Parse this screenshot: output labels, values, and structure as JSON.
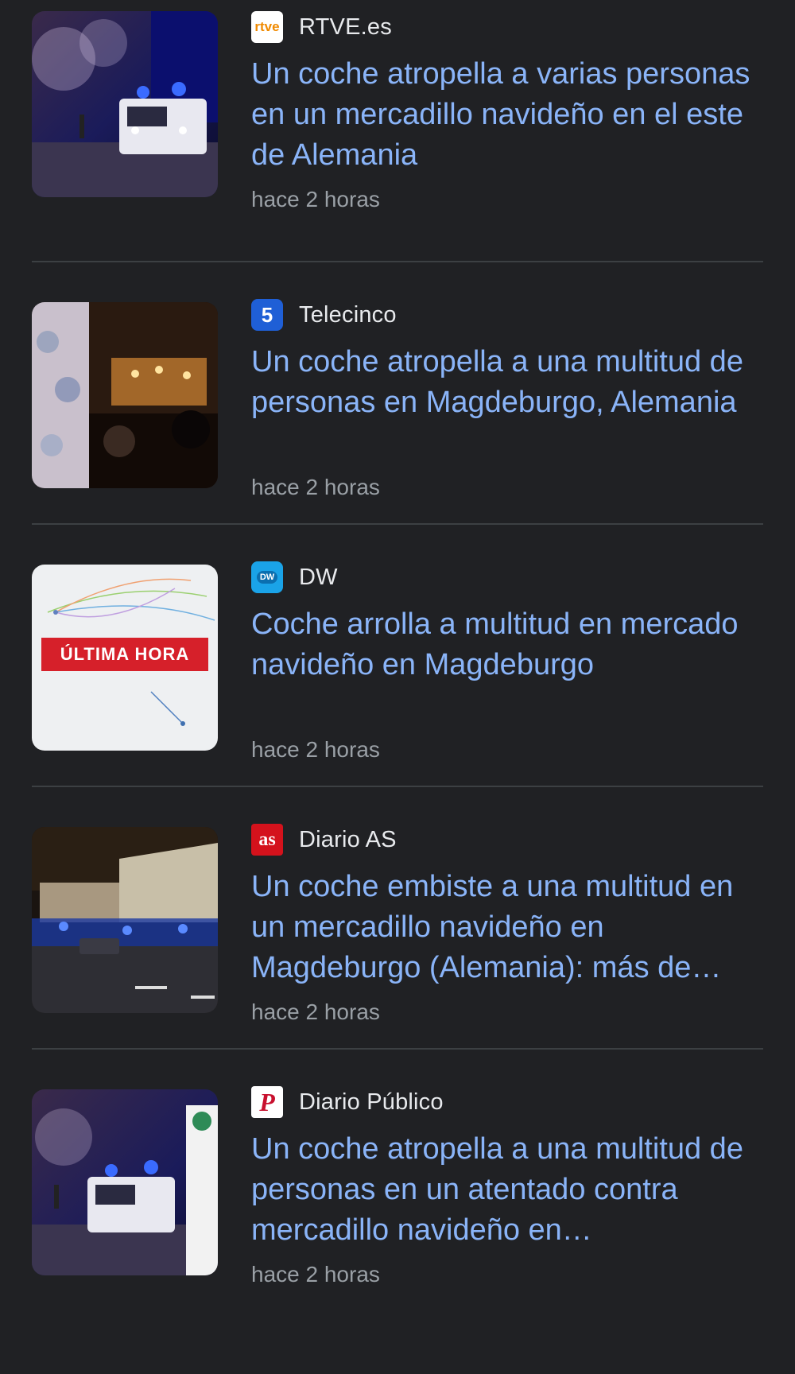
{
  "colors": {
    "background": "#202124",
    "headline": "#8ab4f8",
    "source": "#e8eaed",
    "timestamp": "#9aa0a6",
    "divider": "#3c4043"
  },
  "articles": [
    {
      "source": "RTVE.es",
      "logo_icon": "rtve-logo-icon",
      "logo_text": "rtve",
      "headline": "Un coche atropella a varias personas en un mercadillo navideño en el este de Alemania",
      "time": "hace 2 horas"
    },
    {
      "source": "Telecinco",
      "logo_icon": "telecinco-logo-icon",
      "logo_text": "5",
      "headline": "Un coche atropella a una multitud de personas en Magdeburgo, Alemania",
      "time": "hace 2 horas"
    },
    {
      "source": "DW",
      "logo_icon": "dw-logo-icon",
      "logo_text": "DW",
      "headline": "Coche arrolla a multitud en mercado navideño en Magdeburgo",
      "time": "hace 2 horas",
      "thumb_text": "ÚLTIMA HORA"
    },
    {
      "source": "Diario AS",
      "logo_icon": "diario-as-logo-icon",
      "logo_text": "as",
      "headline": "Un coche embiste a una multitud en un mercadillo navideño en Magdeburgo (Alemania): más de…",
      "time": "hace 2 horas"
    },
    {
      "source": "Diario Público",
      "logo_icon": "publico-logo-icon",
      "logo_text": "P",
      "headline": "Un coche atropella a una multitud de personas en un atentado contra mercadillo navideño en…",
      "time": "hace 2 horas"
    }
  ]
}
